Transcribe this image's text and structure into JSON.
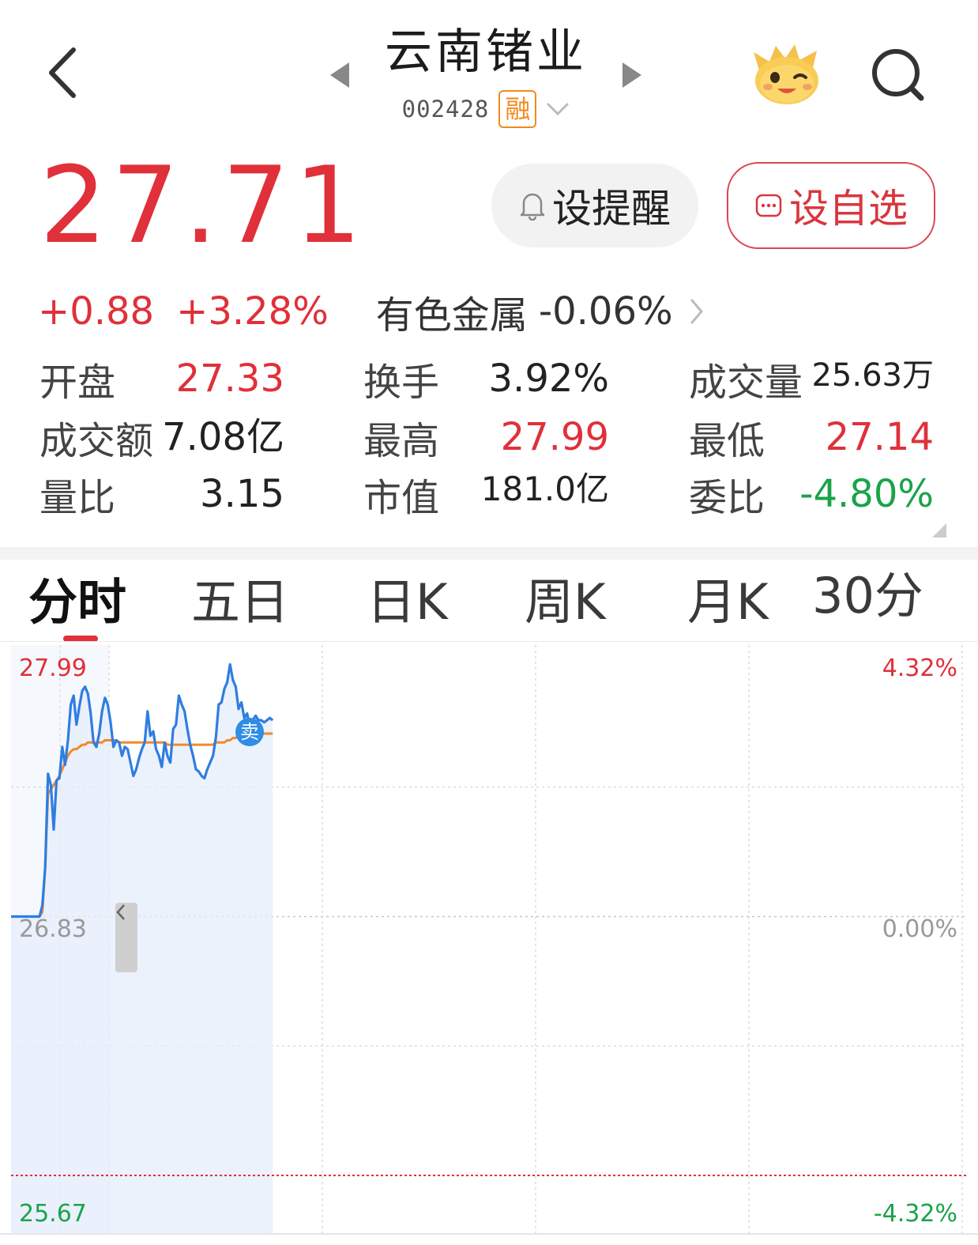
{
  "header": {
    "stock_name": "云南锗业",
    "stock_code": "002428",
    "margin_badge": "融"
  },
  "quote": {
    "price": "27.71",
    "change_abs": "+0.88",
    "change_pct": "+3.28%",
    "sector_name": "有色金属",
    "sector_change": "-0.06%"
  },
  "buttons": {
    "alert_label": "设提醒",
    "watchlist_label": "设自选"
  },
  "stats": [
    {
      "label": "开盘",
      "value": "27.33",
      "color": "red"
    },
    {
      "label": "换手",
      "value": "3.92%",
      "color": "dark"
    },
    {
      "label": "成交量",
      "value": "25.63万",
      "color": "dark"
    },
    {
      "label": "成交额",
      "value": "7.08亿",
      "color": "dark"
    },
    {
      "label": "最高",
      "value": "27.99",
      "color": "red"
    },
    {
      "label": "最低",
      "value": "27.14",
      "color": "red"
    },
    {
      "label": "量比",
      "value": "3.15",
      "color": "dark"
    },
    {
      "label": "市值",
      "value": "181.0亿",
      "color": "dark"
    },
    {
      "label": "委比",
      "value": "-4.80%",
      "color": "green"
    }
  ],
  "tabs": [
    "分时",
    "五日",
    "日K",
    "周K",
    "月K",
    "30分"
  ],
  "active_tab": "分时",
  "colors": {
    "up": "#e0303a",
    "down": "#1aa34a",
    "price_line": "#2f7de1",
    "avg_line": "#f08a2c"
  },
  "chart_data": {
    "type": "line",
    "title": "",
    "y_left_labels": [
      "27.99",
      "26.83",
      "25.67"
    ],
    "y_right_labels": [
      "4.32%",
      "0.00%",
      "-4.32%"
    ],
    "ylim": [
      25.67,
      27.99
    ],
    "prev_close": 26.83,
    "marker_label": "卖",
    "series": [
      {
        "values": [
          26.83,
          26.83,
          26.83,
          26.83,
          26.83,
          26.83,
          26.83,
          26.83,
          26.83,
          26.83,
          26.83,
          26.88,
          27.05,
          27.47,
          27.42,
          27.22,
          27.44,
          27.45,
          27.59,
          27.51,
          27.62,
          27.78,
          27.82,
          27.69,
          27.77,
          27.84,
          27.86,
          27.83,
          27.74,
          27.61,
          27.59,
          27.65,
          27.75,
          27.81,
          27.78,
          27.7,
          27.59,
          27.62,
          27.61,
          27.55,
          27.59,
          27.58,
          27.52,
          27.46,
          27.49,
          27.54,
          27.58,
          27.61,
          27.75,
          27.64,
          27.66,
          27.58,
          27.55,
          27.5,
          27.61,
          27.55,
          27.52,
          27.67,
          27.69,
          27.82,
          27.78,
          27.75,
          27.67,
          27.6,
          27.55,
          27.49,
          27.48,
          27.46,
          27.45,
          27.49,
          27.52,
          27.55,
          27.63,
          27.78,
          27.79,
          27.85,
          27.88,
          27.96,
          27.89,
          27.86,
          27.76,
          27.79,
          27.72,
          27.74,
          27.68,
          27.71,
          27.73,
          27.71,
          27.71,
          27.7,
          27.71,
          27.72,
          27.71
        ]
      },
      {
        "values": [
          26.83,
          26.83,
          26.83,
          26.83,
          26.83,
          26.83,
          26.83,
          26.83,
          26.83,
          26.83,
          26.83,
          26.85,
          27.05,
          27.38,
          27.4,
          27.42,
          27.44,
          27.46,
          27.49,
          27.52,
          27.55,
          27.57,
          27.58,
          27.58,
          27.59,
          27.6,
          27.6,
          27.61,
          27.61,
          27.61,
          27.61,
          27.61,
          27.61,
          27.62,
          27.62,
          27.62,
          27.62,
          27.62,
          27.61,
          27.61,
          27.61,
          27.61,
          27.61,
          27.61,
          27.61,
          27.61,
          27.61,
          27.61,
          27.61,
          27.61,
          27.61,
          27.61,
          27.61,
          27.61,
          27.61,
          27.6,
          27.6,
          27.6,
          27.6,
          27.6,
          27.6,
          27.6,
          27.6,
          27.6,
          27.6,
          27.6,
          27.6,
          27.6,
          27.6,
          27.6,
          27.6,
          27.6,
          27.61,
          27.61,
          27.61,
          27.61,
          27.62,
          27.62,
          27.63,
          27.63,
          27.64,
          27.64,
          27.64,
          27.64,
          27.65,
          27.65,
          27.65,
          27.65,
          27.65,
          27.65,
          27.65,
          27.65,
          27.65
        ]
      }
    ]
  }
}
